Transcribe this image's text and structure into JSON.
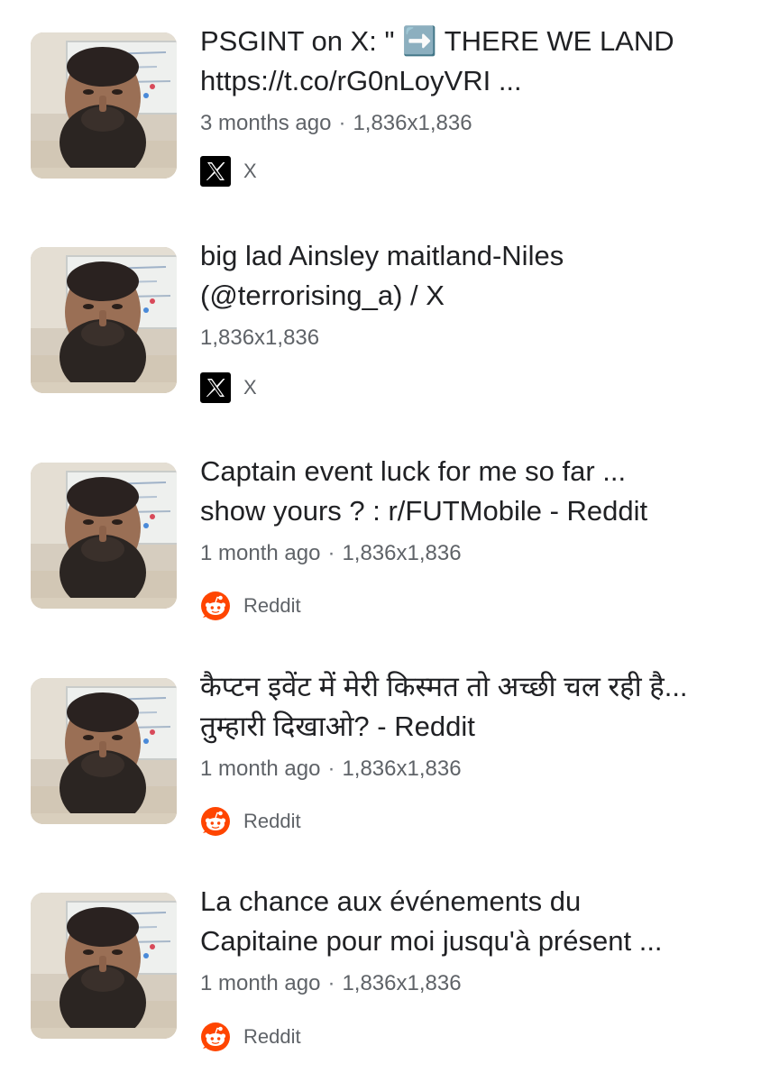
{
  "results": [
    {
      "title_line1": "PSGINT on X: \" ➡️ THERE WE LAND",
      "title_line2": "https://t.co/rG0nLoyVRI ...",
      "time": "3 months ago",
      "dimensions": "1,836x1,836",
      "source": "X",
      "source_icon": "x-logo-icon"
    },
    {
      "title_line1": "big lad Ainsley maitland-Niles",
      "title_line2": "(@terrorising_a) / X",
      "time": "",
      "dimensions": "1,836x1,836",
      "source": "X",
      "source_icon": "x-logo-icon"
    },
    {
      "title_line1": "Captain event luck for me so far ...",
      "title_line2": "show yours ? : r/FUTMobile - Reddit",
      "time": "1 month ago",
      "dimensions": "1,836x1,836",
      "source": "Reddit",
      "source_icon": "reddit-logo-icon"
    },
    {
      "title_line1": "कैप्टन इवेंट में मेरी किस्मत तो अच्छी चल रही है...",
      "title_line2": "तुम्हारी दिखाओ? - Reddit",
      "time": "1 month ago",
      "dimensions": "1,836x1,836",
      "source": "Reddit",
      "source_icon": "reddit-logo-icon"
    },
    {
      "title_line1": "La chance aux événements du",
      "title_line2": "Capitaine pour moi jusqu'à présent ...",
      "time": "1 month ago",
      "dimensions": "1,836x1,836",
      "source": "Reddit",
      "source_icon": "reddit-logo-icon"
    }
  ],
  "colors": {
    "title": "#202124",
    "meta": "#5f6368",
    "reddit_orange": "#ff4500"
  }
}
